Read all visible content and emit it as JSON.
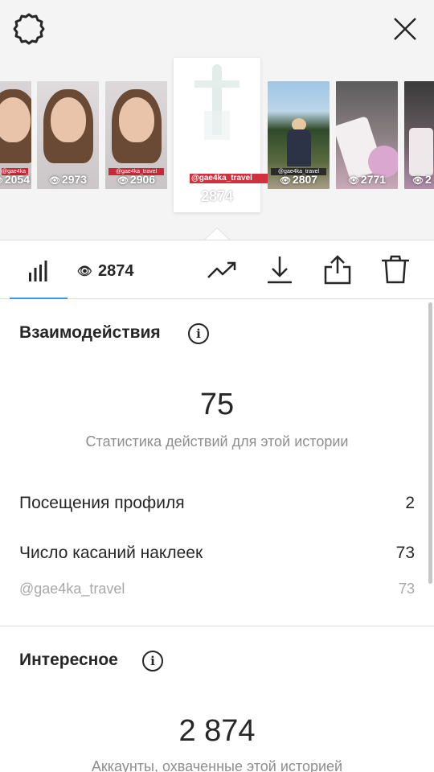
{
  "icons": {
    "settings": "gear-icon",
    "close": "close-icon",
    "insights": "bar-chart-icon",
    "views_eye": "eye-icon",
    "trend": "trending-up-icon",
    "download": "download-icon",
    "share": "share-icon",
    "delete": "trash-icon",
    "info": "info-icon"
  },
  "colors": {
    "accent": "#3897f0",
    "tag_red": "#d03040",
    "text": "#262626",
    "muted": "#8e8e8e"
  },
  "story_strip": {
    "thumbs": [
      {
        "views": "2054"
      },
      {
        "views": "2973"
      },
      {
        "views": "2906"
      },
      {
        "views": "2807"
      },
      {
        "views": "2771"
      },
      {
        "views": "2"
      }
    ],
    "selected": {
      "tag": "@gae4ka_travel",
      "views": "2874"
    }
  },
  "tabbar": {
    "views_count": "2874",
    "info_glyph": "i"
  },
  "interactions": {
    "title": "Взаимодействия",
    "total": "75",
    "caption": "Статистика действий для этой истории",
    "rows": [
      {
        "label": "Посещения профиля",
        "value": "2"
      },
      {
        "label": "Число касаний наклеек",
        "value": "73"
      }
    ],
    "sub_row": {
      "label": "@gae4ka_travel",
      "value": "73"
    }
  },
  "discovery": {
    "title": "Интересное",
    "total": "2 874",
    "caption": "Аккаунты, охваченные этой историей"
  }
}
